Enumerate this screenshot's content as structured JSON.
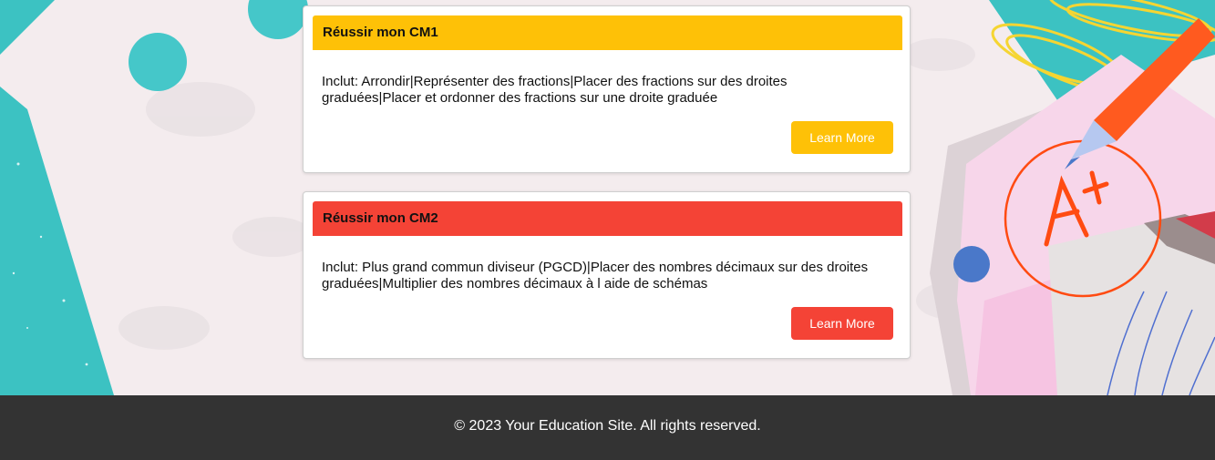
{
  "colors": {
    "yellow_accent": "#FEC107",
    "red_accent": "#F44336",
    "footer_bg": "#333333",
    "teal": "#3CC2C2",
    "page_bg": "#F4ECEE"
  },
  "courses": [
    {
      "title": "Réussir mon CM1",
      "description": "Inclut: Arrondir|Représenter des fractions|Placer des fractions sur des droites graduées|Placer et ordonner des fractions sur une droite graduée",
      "button_label": "Learn More",
      "accent_color": "#FEC107"
    },
    {
      "title": "Réussir mon CM2",
      "description": "Inclut: Plus grand commun diviseur (PGCD)|Placer des nombres décimaux sur des droites graduées|Multiplier des nombres décimaux à l aide de schémas",
      "button_label": "Learn More",
      "accent_color": "#F44336"
    }
  ],
  "footer": {
    "copyright": "© 2023 Your Education Site. All rights reserved."
  },
  "decoration": {
    "grade_mark": "A+"
  }
}
